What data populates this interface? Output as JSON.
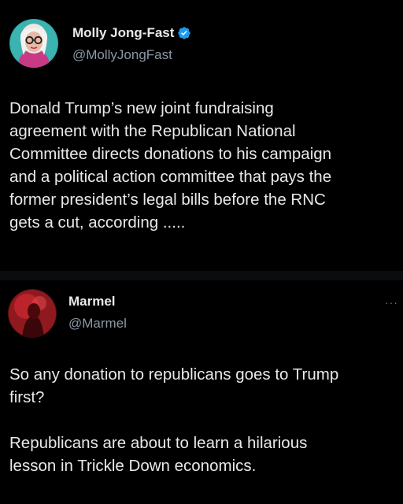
{
  "tweets": [
    {
      "display_name": "Molly Jong-Fast",
      "handle": "@MollyJongFast",
      "verified": true,
      "avatar_icon": "profile-photo-woman-glasses",
      "body_lines": [
        "Donald Trump’s new joint fundraising",
        "agreement with the Republican National",
        "Committee directs donations to his campaign",
        "and a political action committee that pays the",
        "former president’s legal bills before the RNC",
        "gets a cut, according ....."
      ]
    },
    {
      "display_name": "Marmel",
      "handle": "@Marmel",
      "verified": false,
      "avatar_icon": "profile-photo-red",
      "more_icon": "more-options-icon",
      "body_lines": [
        "So any donation to republicans goes to Trump",
        "first?",
        "",
        "Republicans are about to learn a hilarious",
        "lesson in Trickle Down economics."
      ]
    }
  ],
  "colors": {
    "background": "#000000",
    "text": "#e7e9ea",
    "secondary_text": "#8b98a5",
    "verified_blue": "#1d9bf0"
  }
}
